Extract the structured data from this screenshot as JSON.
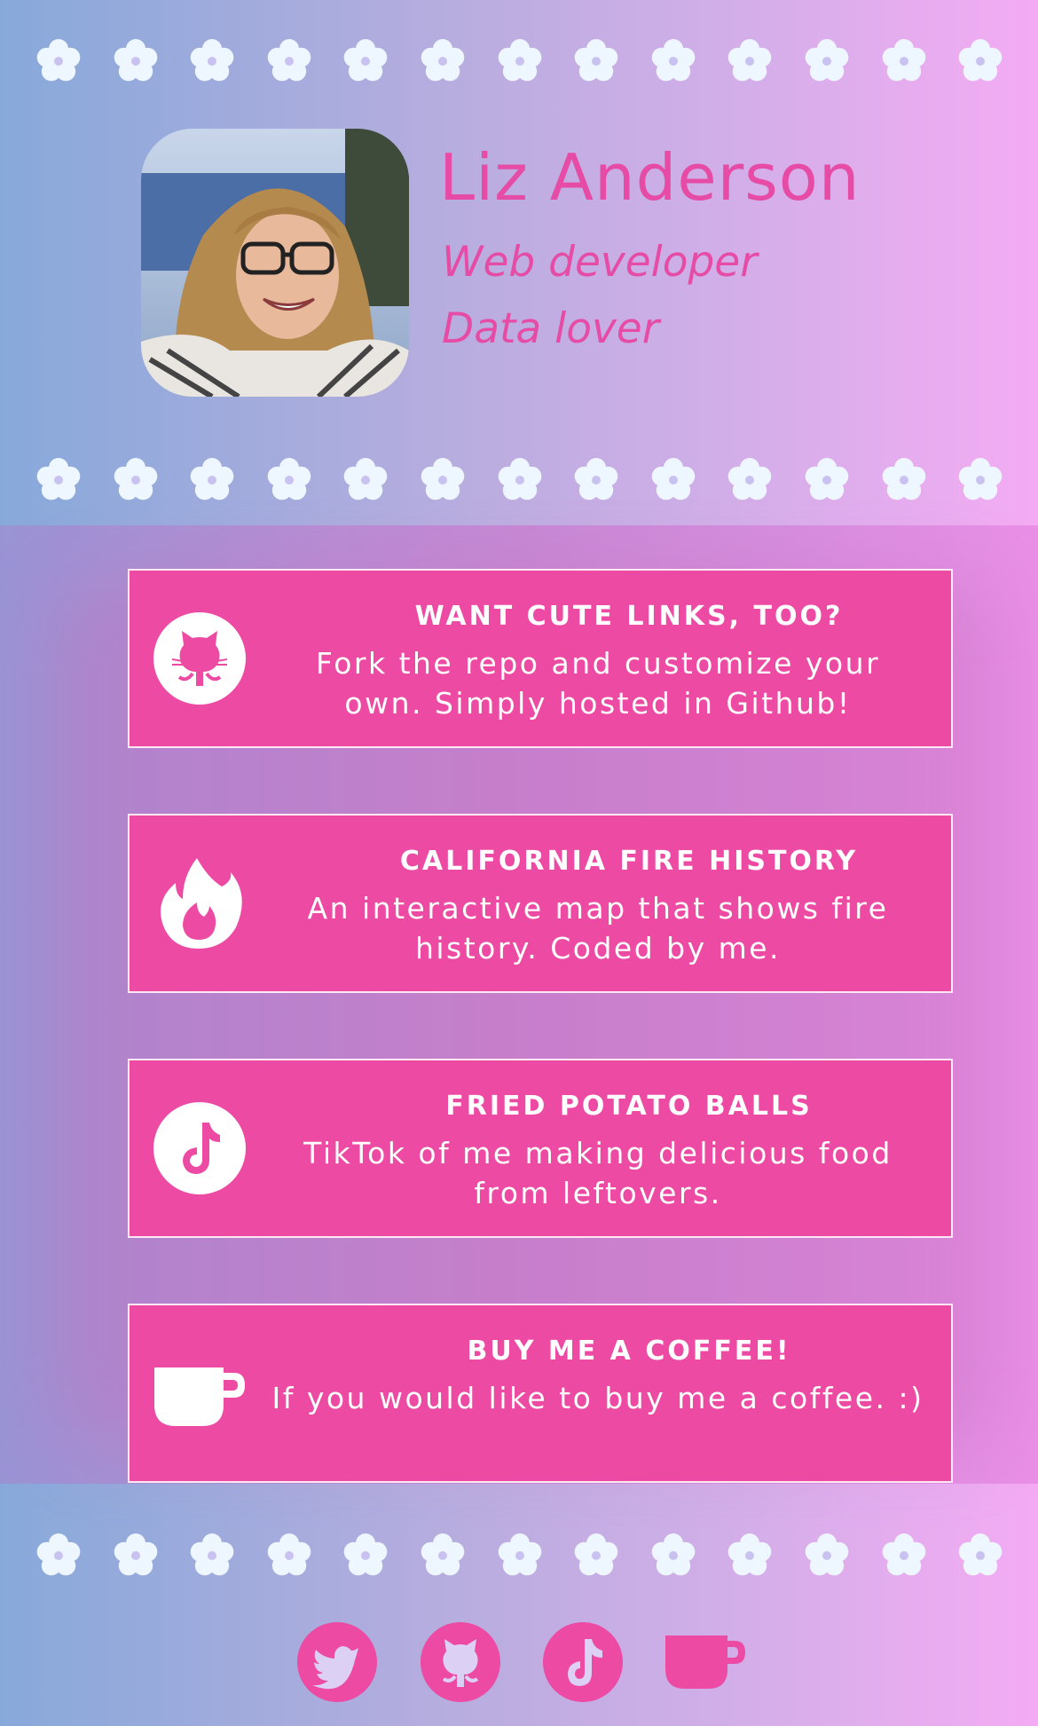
{
  "profile": {
    "name": "Liz Anderson",
    "taglines": [
      "Web developer",
      "Data lover"
    ]
  },
  "links": [
    {
      "icon": "github-icon",
      "title": "WANT CUTE LINKS, TOO?",
      "description": "Fork the repo and customize your own. Simply hosted in Github!"
    },
    {
      "icon": "fire-icon",
      "title": "CALIFORNIA FIRE HISTORY",
      "description": "An interactive map that shows fire history. Coded by me."
    },
    {
      "icon": "tiktok-icon",
      "title": "FRIED POTATO BALLS",
      "description": "TikTok of me making delicious food from leftovers."
    },
    {
      "icon": "coffee-cup-icon",
      "title": "BUY ME A COFFEE!",
      "description": "If you would like to buy me a coffee. :)"
    }
  ],
  "social": [
    "twitter-icon",
    "github-icon",
    "tiktok-icon",
    "coffee-cup-icon"
  ],
  "colors": {
    "accent": "#ec4aa3",
    "flower": "#eef6ff",
    "gradient_left": "#87a9da",
    "gradient_right": "#f4abf3"
  }
}
